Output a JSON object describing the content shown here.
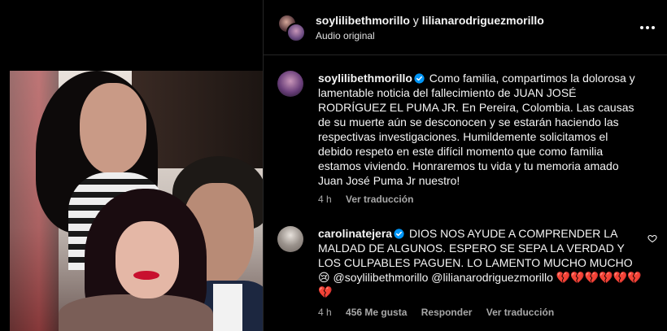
{
  "header": {
    "user1": "soylilibethmorillo",
    "connector": "y",
    "user2": "lilianarodriguezmorillo",
    "audio": "Audio original"
  },
  "caption": {
    "username": "soylilibethmorillo",
    "text": "Como familia, compartimos la dolorosa y lamentable noticia del fallecimiento de JUAN JOSÉ RODRÍGUEZ EL PUMA JR. En Pereira, Colombia. Las causas de su muerte aún se desconocen y se estarán haciendo las respectivas investigaciones. Humildemente solicitamos el debido respeto en este difícil momento que como familia estamos viviendo. Honraremos tu vida y tu memoria amado Juan José Puma Jr nuestro!",
    "time": "4 h",
    "translate": "Ver traducción"
  },
  "comment": {
    "username": "carolinatejera",
    "text": "DIOS NOS AYUDE A COMPRENDER LA MALDAD DE ALGUNOS. ESPERO SE SEPA LA VERDAD Y LOS CULPABLES PAGUEN. LO LAMENTO MUCHO MUCHO 😢 @soylilibethmorillo @lilianarodriguezmorillo 💔💔💔💔💔💔💔",
    "time": "4 h",
    "likes": "456 Me gusta",
    "reply": "Responder",
    "translate": "Ver traducción"
  },
  "colors": {
    "background": "#000000",
    "text": "#f5f5f5",
    "muted": "#a8a8a8",
    "verified": "#0095f6",
    "divider": "#262626"
  },
  "icons": [
    "more-options-icon",
    "verified-badge-icon",
    "heart-icon"
  ]
}
